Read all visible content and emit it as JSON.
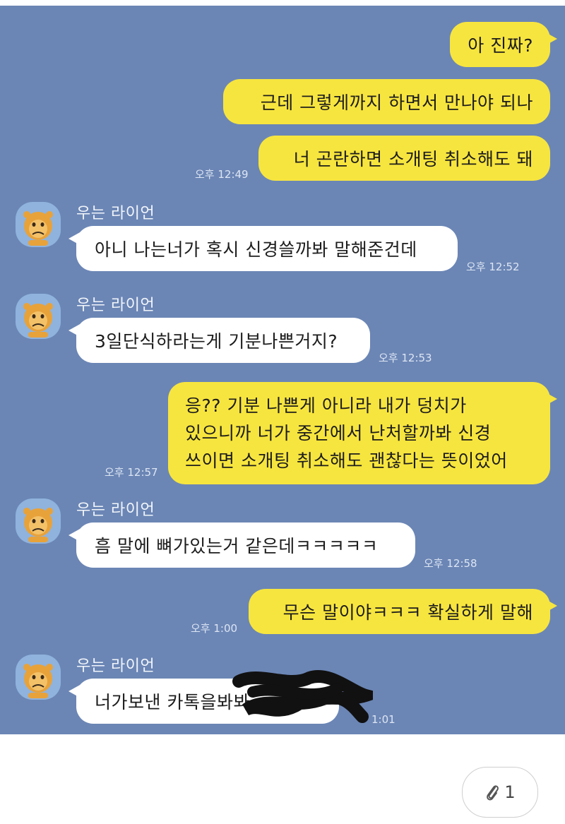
{
  "chat": {
    "sender_name": "우는 라이언",
    "messages": [
      {
        "text": "아 진짜?"
      },
      {
        "text": "근데 그렇게까지 하면서 만나야 되나"
      },
      {
        "text": "너 곤란하면 소개팅 취소해도 돼",
        "time": "오후 12:49"
      },
      {
        "text": "아니 나는너가 혹시 신경쓸까봐 말해준건데",
        "time": "오후 12:52"
      },
      {
        "text": "3일단식하라는게 기분나쁜거지?",
        "time": "오후 12:53"
      },
      {
        "lines": [
          "응?? 기분 나쁜게 아니라 내가 덩치가",
          "있으니까 너가 중간에서 난처할까봐 신경",
          "쓰이면 소개팅 취소해도 괜찮다는 뜻이었어"
        ],
        "time": "오후 12:57"
      },
      {
        "text": "흠 말에 뼈가있는거 같은데ㅋㅋㅋㅋㅋ",
        "time": "오후 12:58"
      },
      {
        "text": "무슨 말이야ㅋㅋㅋ 확실하게 말해",
        "time": "오후 1:00"
      },
      {
        "text": "너가보낸 카톡을봐봐",
        "time": "1:01"
      }
    ]
  },
  "attachment": {
    "count": "1",
    "icon": "paperclip-icon"
  },
  "colors": {
    "chat_bg": "#6b86b5",
    "outgoing": "#f7e53f",
    "incoming": "#ffffff"
  }
}
